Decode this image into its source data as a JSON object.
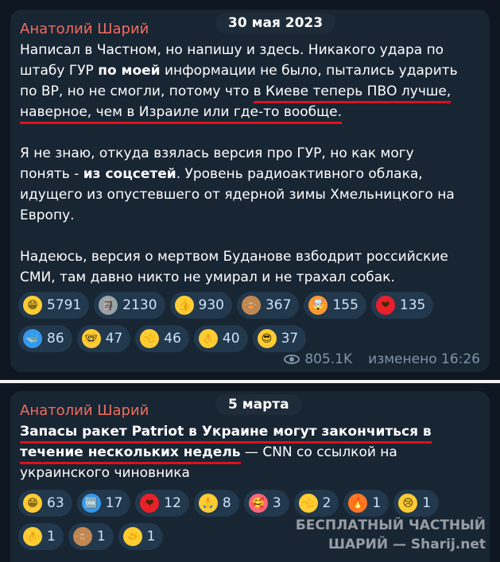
{
  "post1": {
    "author": "Анатолий Шарий",
    "date": "30 мая 2023",
    "lines": [
      [
        "Написал в Частном, но напишу и здесь. Никакого удара по"
      ],
      [
        "штабу ГУР ",
        "по моей",
        " информации не было, пытались ударить"
      ],
      [
        "по ВР, но не смогли, потому что ",
        "в Киеве теперь ПВО лучше,"
      ],
      [
        "наверное, чем в Израиле или где-то вообще."
      ],
      [
        "Я не знаю, откуда взялась версия про ГУР, но как могу"
      ],
      [
        "понять - ",
        "из соцсетей",
        ". Уровень радиоактивного облака,"
      ],
      [
        "идущего из опустевшего от ядерной зимы Хмельницкого на"
      ],
      [
        "Европу."
      ],
      [
        "Надеюсь, версия о мертвом Буданове взбодрит российские"
      ],
      [
        "СМИ, там давно никто не умирал и не трахал собак."
      ]
    ],
    "reactions": [
      {
        "icon": "grinning-face-icon",
        "count": "5791",
        "color": "#ffcc33"
      },
      {
        "icon": "moai-icon",
        "count": "2130",
        "color": "#9aa3a8"
      },
      {
        "icon": "thumbs-up-icon",
        "count": "930",
        "color": "#ffcc33"
      },
      {
        "icon": "see-no-evil-monkey-icon",
        "count": "367",
        "color": "#c08850"
      },
      {
        "icon": "exploding-head-icon",
        "count": "155",
        "color": "#ff9933"
      },
      {
        "icon": "red-heart-icon",
        "count": "135",
        "color": "#e8202a"
      },
      {
        "icon": "whale-icon",
        "count": "86",
        "color": "#3399ee"
      },
      {
        "icon": "nerd-face-icon",
        "count": "47",
        "color": "#ffcc33"
      },
      {
        "icon": "pointing-hand-icon",
        "count": "46",
        "color": "#ffcc33"
      },
      {
        "icon": "ok-hand-icon",
        "count": "40",
        "color": "#ffcc33"
      },
      {
        "icon": "smiling-sunglasses-icon",
        "count": "37",
        "color": "#ffcc33"
      }
    ],
    "views": "805.1K",
    "edited": "изменено 16:26"
  },
  "post2": {
    "author": "Анатолий Шарий",
    "date": "5 марта",
    "lines": [
      [
        "Запасы ракет Patriot в Украине могут закончиться в"
      ],
      [
        "течение нескольких недель",
        " — CNN со ссылкой на"
      ],
      [
        "украинского чиновника"
      ]
    ],
    "reactions": [
      {
        "icon": "grinning-face-icon",
        "count": "63",
        "color": "#ffcc33"
      },
      {
        "icon": "cool-button-icon",
        "count": "17",
        "color": "#3399ee"
      },
      {
        "icon": "red-heart-icon",
        "count": "12",
        "color": "#e8202a"
      },
      {
        "icon": "folded-hands-icon",
        "count": "8",
        "color": "#ffcc33"
      },
      {
        "icon": "hearts-face-icon",
        "count": "3",
        "color": "#ff6677"
      },
      {
        "icon": "pointing-hand-icon",
        "count": "2",
        "color": "#ffcc33"
      },
      {
        "icon": "fire-icon",
        "count": "1",
        "color": "#ff7722"
      },
      {
        "icon": "crying-face-icon",
        "count": "1",
        "color": "#ffcc33"
      },
      {
        "icon": "ok-hand-icon",
        "count": "1",
        "color": "#ffcc33"
      },
      {
        "icon": "see-no-evil-monkey-icon",
        "count": "1",
        "color": "#c08850"
      },
      {
        "icon": "handshake-icon",
        "count": "1",
        "color": "#ffcc33"
      }
    ]
  },
  "watermark": {
    "line1": "БЕСПЛАТНЫЙ ЧАСТНЫЙ",
    "line2": "ШАРИЙ — Sharij.net"
  }
}
